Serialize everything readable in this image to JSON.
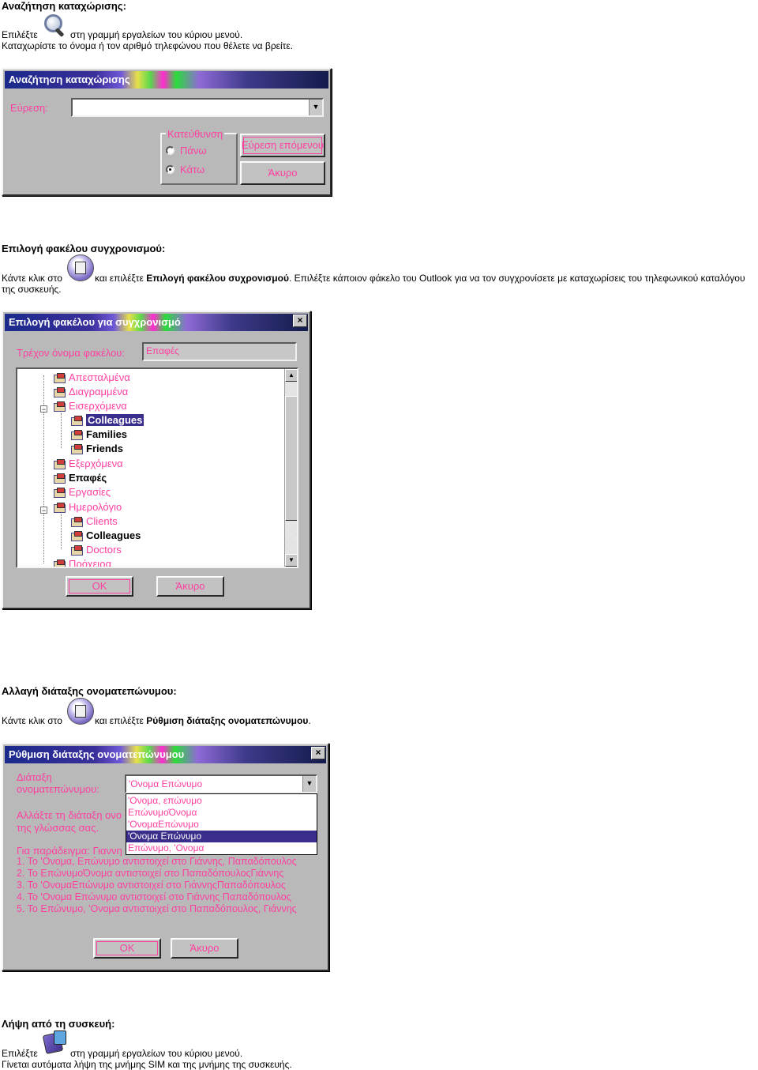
{
  "section_search": {
    "heading": "Αναζήτηση καταχώρισης:",
    "line1_before": "Επιλέξτε",
    "line1_after": "στη γραμμή εργαλείων του κύριου μενού.",
    "line2": "Καταχωρίστε το όνομα ή τον αριθμό τηλεφώνου που θέλετε να βρείτε.",
    "icon": "magnifier-icon",
    "dialog": {
      "title": "Αναζήτηση καταχώρισης",
      "find_label": "Εύρεση:",
      "find_value": "",
      "direction_label": "Κατεύθυνση",
      "up_label": "Πάνω",
      "down_label": "Κάτω",
      "selected_direction": "Κάτω",
      "find_next_button": "Εύρεση επόμενου",
      "cancel_button": "Άκυρο"
    }
  },
  "section_sync": {
    "heading": "Επιλογή φακέλου συγχρονισμού:",
    "text_before": "Κάντε κλικ στο",
    "text_mid": "και επιλέξτε",
    "text_bold": "Επιλογή φακέλου συχρονισμού",
    "text_after": ". Επιλέξτε κάποιον φάκελο του Outlook για να τον συγχρονίσετε με καταχωρίσεις του τηλεφωνικού καταλόγου",
    "text_line2": "της συσκευής.",
    "icon": "sync-icon",
    "dialog": {
      "title": "Επιλογή φακέλου για συγχρονισμό",
      "current_label": "Τρέχον όνομα φακέλου:",
      "current_value": "Επαφές",
      "folders": [
        {
          "label": "Απεσταλμένα",
          "level": 1,
          "bold": false
        },
        {
          "label": "Διαγραμμένα",
          "level": 1,
          "bold": false
        },
        {
          "label": "Εισερχόμενα",
          "level": 1,
          "bold": false,
          "expander": "minus"
        },
        {
          "label": "Colleagues",
          "level": 2,
          "bold": true,
          "selected": true
        },
        {
          "label": "Families",
          "level": 2,
          "bold": true
        },
        {
          "label": "Friends",
          "level": 2,
          "bold": true
        },
        {
          "label": "Εξερχόμενα",
          "level": 1,
          "bold": false
        },
        {
          "label": "Επαφές",
          "level": 1,
          "bold": true
        },
        {
          "label": "Εργασίες",
          "level": 1,
          "bold": false
        },
        {
          "label": "Ημερολόγιο",
          "level": 1,
          "bold": false,
          "expander": "minus"
        },
        {
          "label": "Clients",
          "level": 2,
          "bold": false
        },
        {
          "label": "Colleagues",
          "level": 2,
          "bold": true
        },
        {
          "label": "Doctors",
          "level": 2,
          "bold": false
        },
        {
          "label": "Πρόχειρα",
          "level": 1,
          "bold": false
        }
      ],
      "ok_button": "OK",
      "cancel_button": "Άκυρο"
    }
  },
  "section_order": {
    "heading": "Αλλαγή διάταξης ονοματεπώνυμου:",
    "text_before": "Κάντε κλικ στο",
    "text_mid": "και επιλέξτε",
    "text_bold": "Ρύθμιση διάταξης ονοματεπώνυμου",
    "text_after": ".",
    "icon": "sync-icon",
    "dialog": {
      "title": "Ρύθμιση διάταξης ονοματεπώνυμου",
      "order_label_1": "Διάταξη",
      "order_label_2": "ονοματεπώνυμου:",
      "selected_value": "'Ονομα Επώνυμο",
      "options": [
        "'Ονομα, επώνυμο",
        "ΕπώνυμοΌνομα",
        "'ΟνομαΕπώνυμο",
        "'Ονομα Επώνυμο",
        "Επώνυμο, 'Ονομα"
      ],
      "selected_index": 3,
      "change_text_1": "Αλλάξτε τη διάταξη ονο",
      "change_text_2": "της γλώσσας σας.",
      "example_intro": "Για παράδειγμα: Γιαννη",
      "examples": [
        "1. Το 'Ονομα, Επώνυμο αντιστοιχεί στο Γιάννης, Παπαδόπουλος",
        "2. Το ΕπώνυμοΌνομα αντιστοιχεί στο ΠαπαδόπουλοςΓιάννης",
        "3. Το 'ΟνομαΕπώνυμο αντιστοιχεί στο ΓιάννηςΠαπαδόπουλος",
        "4. Το 'Ονομα Επώνυμο αντιστοιχεί στο Γιάννης Παπαδόπουλος",
        "5. Το Επώνυμο, 'Ονομα αντιστοιχεί στο Παπαδόπουλος, Γιάννης"
      ],
      "ok_button": "OK",
      "cancel_button": "Άκυρο"
    }
  },
  "section_download": {
    "heading": "Λήψη από τη συσκευή:",
    "line1_before": "Επιλέξτε",
    "line1_after": "στη γραμμή εργαλείων του κύριου μενού.",
    "line2": "Γίνεται αυτόματα λήψη της μνήμης SIM και της μνήμης της συσκευής.",
    "icon": "download-icon"
  },
  "colors": {
    "dialog_bg": "#b9b9b9",
    "label_pink": "#ff3fa0",
    "selection": "#3a2e8c"
  }
}
